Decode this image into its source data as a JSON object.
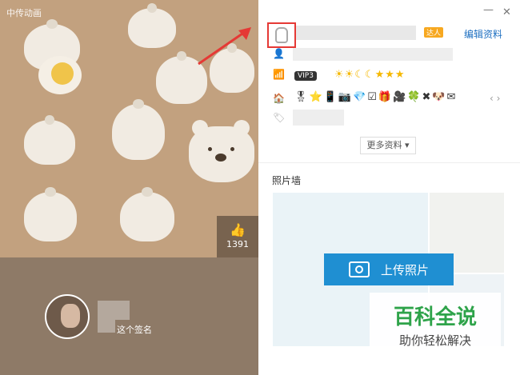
{
  "app": {
    "brand": "中传动画"
  },
  "window": {
    "minimize_icon": "—",
    "close_icon": "✕"
  },
  "profile": {
    "edit_label": "编辑资料",
    "badge_label": "达人",
    "vip_label": "VIP3",
    "more_label": "更多资料 ▾"
  },
  "cover": {
    "like_count": "1391",
    "signature_text": "这个签名"
  },
  "photo_wall": {
    "title": "照片墙",
    "upload_label": "上传照片"
  },
  "watermark": {
    "title": "百科全说",
    "subtitle": "助你轻松解决"
  },
  "colors": {
    "highlight": "#e53935",
    "accent": "#1f8fd2",
    "link": "#1d6fc1"
  }
}
